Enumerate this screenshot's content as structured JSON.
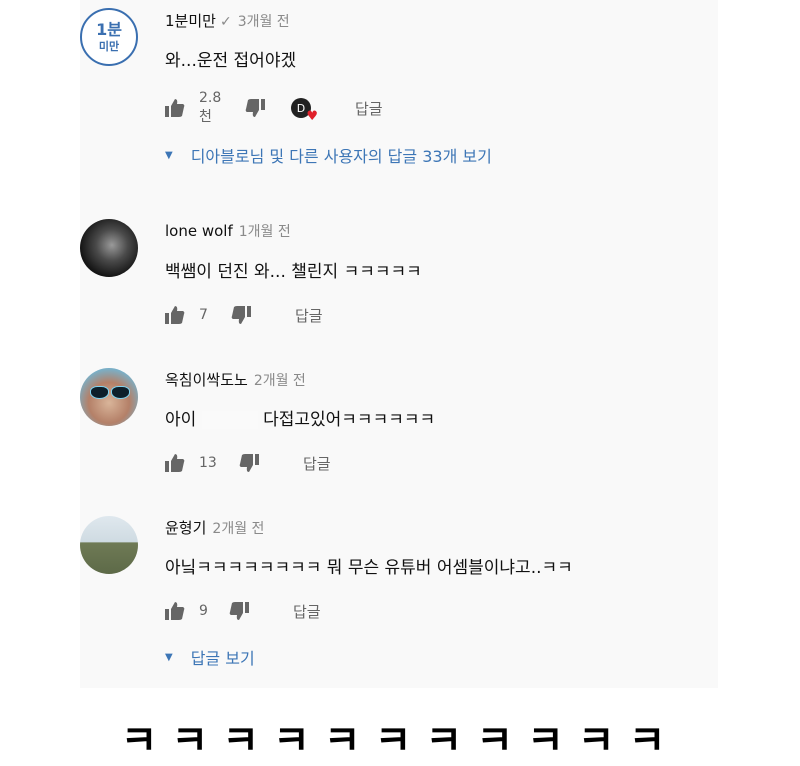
{
  "comments": [
    {
      "avatar": {
        "line1": "1분",
        "line2": "미만"
      },
      "author": "1분미만",
      "verified_mark": "✓",
      "time": "3개월 전",
      "text": "와...운전 접어야겠",
      "likes": "2.8천",
      "reply_label": "답글",
      "hearted_by_initial": "D",
      "view_replies": "디아블로님 및 다른 사용자의 답글 33개 보기"
    },
    {
      "author": "lone wolf",
      "time": "1개월 전",
      "text": "백쌤이 던진 와... 챌린지 ㅋㅋㅋㅋㅋ",
      "likes": "7",
      "reply_label": "답글"
    },
    {
      "author": "옥침이싹도노",
      "time": "2개월 전",
      "text_before": "아이",
      "text_after": "다접고있어ㅋㅋㅋㅋㅋㅋ",
      "likes": "13",
      "reply_label": "답글"
    },
    {
      "author": "윤형기",
      "time": "2개월 전",
      "text": "아닠ㅋㅋㅋㅋㅋㅋㅋㅋ 뭐 무슨 유튜버 어셈블이냐고..ㅋㅋ",
      "likes": "9",
      "reply_label": "답글",
      "view_replies": "답글 보기"
    }
  ],
  "bottom_caption": "ㅋㅋㅋㅋㅋㅋㅋㅋㅋㅋㅋ",
  "colors": {
    "link": "#3d76b6",
    "heart": "#e0202a",
    "badge": "#3a6fb0"
  }
}
